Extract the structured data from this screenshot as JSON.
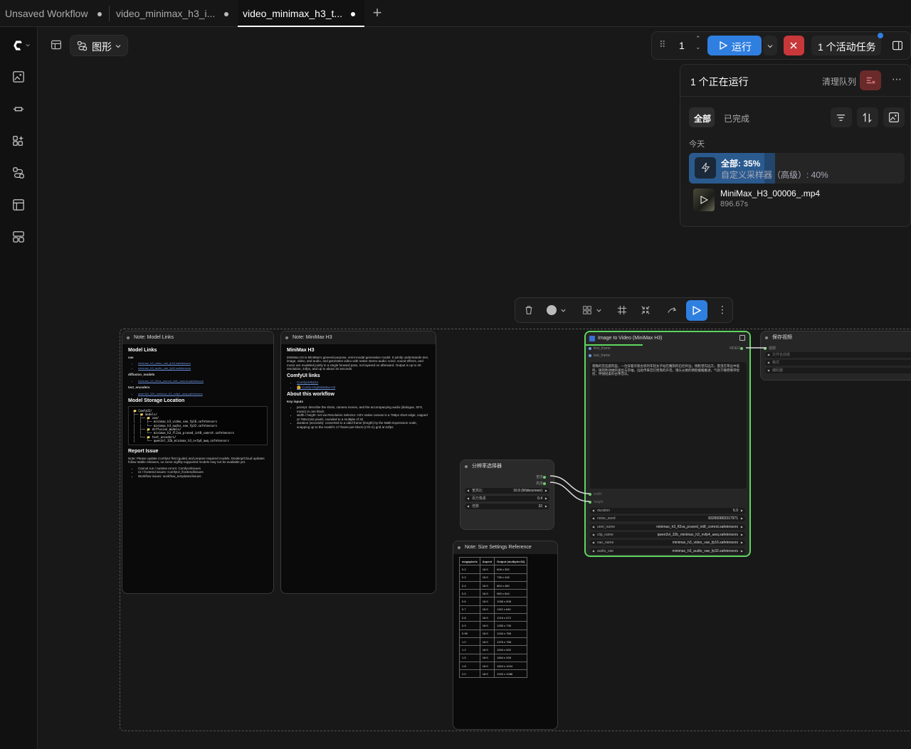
{
  "tabs": [
    {
      "label": "Unsaved Workflow"
    },
    {
      "label": "video_minimax_h3_i..."
    },
    {
      "label": "video_minimax_h3_t..."
    }
  ],
  "toolbar": {
    "view_label": "图形"
  },
  "runbar": {
    "batch_count": "1",
    "run_label": "运行",
    "active_tasks_label": "1 个活动任务"
  },
  "queue": {
    "running_title": "1 个正在运行",
    "clear_label": "清理队列",
    "filter_all": "全部",
    "filter_done": "已完成",
    "today": "今天",
    "progress_main": "全部: 35%",
    "progress_sub": "自定义采样器（高级）: 40%",
    "progress_value": 0.35,
    "item_name": "MiniMax_H3_00006_.mp4",
    "item_time": "896.67s"
  },
  "nodes": {
    "model_links": {
      "title": "Note: Model Links",
      "h_links": "Model Links",
      "vae": "vae",
      "vae_1": "minimax_h3_video_vae_fp16.safetensors",
      "vae_2": "minimax_h3_audio_vae_fp32.safetensors",
      "diff": "diffusion_models",
      "diff_1": "minimax_h3_fl2va_pruned_int8_comrot.safetensors",
      "te": "text_encoders",
      "te_1": "qwen3vl_32b_minimax_h3_nvfp4_awq.safetensors",
      "h_storage": "Model Storage Location",
      "tree": "📁 ComfyUI/\n├── 📁 models/\n│   ├── 📁 vae/\n│   │   ├── minimax_h3_video_vae_fp16.safetensors\n│   │   └── minimax_h3_audio_vae_fp32.safetensors\n│   ├── 📁 diffusion_models/\n│   │   └── minimax_h3_fl2va_pruned_int8_comrot.safetensors\n│   └── 📁 text_encoders/\n│       └── qwen3vl_32b_minimax_h3_nvfp4_awq.safetensors",
      "h_report": "Report Issue",
      "report_text": "Note: Please update ComfyUI first (guide) and prepare required models. Desktop/Cloud updates follow stable releases, so some nightly-supported models may not be available yet.",
      "report_1": "Cannot run / runtime errors: ComfyUI/issues",
      "report_2": "UI / frontend issues: ComfyUI_frontend/issues",
      "report_3": "Workflow issues: workflow_templates/issues"
    },
    "minimax": {
      "title": "Note: MiniMax H3",
      "h1": "MiniMax H3",
      "intro": "MiniMax H3 is MiniMax's general-purpose, omni-modal generation model. It jointly understands text, image, video, and audio, and generates video with native stereo audio: voice, sound effects, and music are modeled jointly in a single forward pass, not layered on afterward. Output is up to 2K resolution, 24fps, and up to about 15 seconds.",
      "h2": "ComfyUI links",
      "link_1": "ComfyUI#5224",
      "link_2": "🤗 Comfy-Org/MiniMax-H3",
      "h3": "About this workflow",
      "key_inputs": "Key inputs",
      "input_1": "prompt: describe the shots, camera moves, and the accompanying audio (dialogue, SFX, music) in one block",
      "input_2": "width / height: set via Resolution Selector. H3's native canvas is a 768px short edge, capped at 768x1344 pixels, rounded to a multiple of 32",
      "input_3": "duration (seconds): converted to a valid frame (length) by the Math Expression node, snapping up to the model's 17-frame-per-block (17k+1) grid at 24fps"
    },
    "resolution": {
      "title": "分辨率选择器",
      "out_width": "宽度",
      "out_height": "高度",
      "w1_label": "宽高比",
      "w1_value": "16:9 (Widescreen)",
      "w2_label": "百万像素",
      "w2_value": "0.4",
      "w3_label": "倍数",
      "w3_value": "32"
    },
    "size_ref": {
      "title": "Note: Size Settings Reference",
      "headers": [
        "megapixels",
        "Aspect",
        "Output (multiple×32)"
      ],
      "rows": [
        [
          "0.2",
          "16:9",
          "608 x 352"
        ],
        [
          "0.3",
          "16:9",
          "736 x 416"
        ],
        [
          "0.4",
          "16:9",
          "864 x 480"
        ],
        [
          "0.5",
          "16:9",
          "960 x 544"
        ],
        [
          "0.6",
          "16:9",
          "1056 x 608"
        ],
        [
          "0.7",
          "16:9",
          "1152 x 640"
        ],
        [
          "0.8",
          "16:9",
          "1216 x 672"
        ],
        [
          "0.9",
          "16:9",
          "1280 x 736"
        ],
        [
          "0.98",
          "16:9",
          "1344 x 768"
        ],
        [
          "1.0",
          "16:9",
          "1376 x 768"
        ],
        [
          "1.2",
          "16:9",
          "1504 x 832"
        ],
        [
          "1.5",
          "16:9",
          "1664 x 928"
        ],
        [
          "1.8",
          "16:9",
          "1824 x 1024"
        ],
        [
          "2.0",
          "16:9",
          "1920 x 1088"
        ]
      ]
    },
    "i2v": {
      "title": "Image to Video (MiniMax H3)",
      "in_first": "first_frame",
      "in_last": "last_frame",
      "out_video": "VIDEO",
      "prompt": "夜晚的宫廷庭院里，一位穿着华丽古装的年轻女子站在雕刻的石栏杆边，侧脸望向远方。夏虫在草丛中低鸣，微风吹动她的发丝与衣袖，远处传来宫灯摇曳的声音。镜头从她的侧脸缓缓推进，气氛宁静而略带忧伤，伴随轻柔的古筝音乐。",
      "in_width": "width",
      "in_height": "height",
      "widgets": [
        {
          "label": "duration",
          "value": "5.0"
        },
        {
          "label": "noise_seed",
          "value": "832650802317971"
        },
        {
          "label": "unet_name",
          "value": "minimax_h3_fl2va_pruned_int8_comrot.safetensors"
        },
        {
          "label": "clip_name",
          "value": "qwen3vl_32b_minimax_h3_nvfp4_awq.safetensors"
        },
        {
          "label": "vae_name",
          "value": "minimax_h3_video_vae_fp16.safetensors"
        },
        {
          "label": "audio_vae",
          "value": "minimax_h3_audio_vae_fp32.safetensors"
        }
      ]
    },
    "save": {
      "title": "保存视频",
      "in_video": "视频",
      "w1": "文件名前缀",
      "w2": "格式",
      "w3": "编码器"
    }
  },
  "colors": {
    "accent": "#2f7fe0",
    "close": "#c8383a",
    "selected_node": "#5fd65f"
  }
}
